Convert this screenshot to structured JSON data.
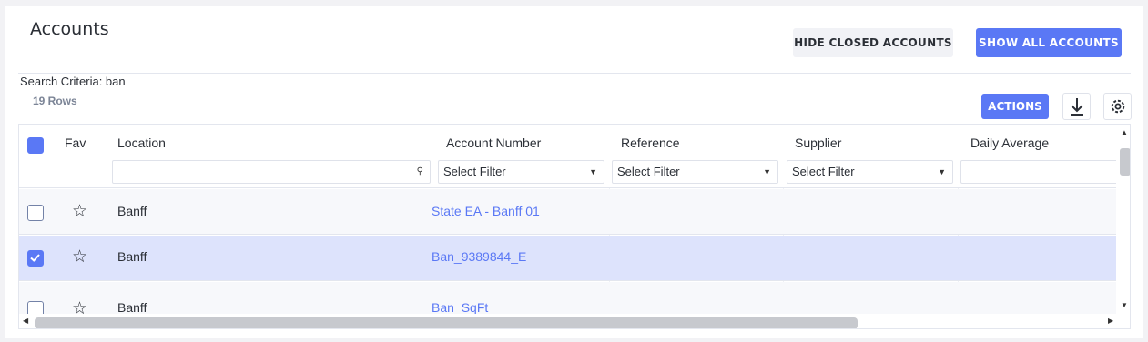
{
  "page": {
    "title": "Accounts"
  },
  "toolbar": {
    "hide_closed_label": "HIDE CLOSED ACCOUNTS",
    "show_all_label": "SHOW ALL ACCOUNTS",
    "actions_label": "ACTIONS"
  },
  "search": {
    "criteria": "Search Criteria: ban",
    "row_count": "19 Rows"
  },
  "icons": {
    "download": "download-icon",
    "settings": "gear-icon",
    "favorite": "star-icon",
    "filter_search": "search-icon"
  },
  "colors": {
    "accent": "#5a78f5",
    "selected_row": "#dde3fc"
  },
  "table": {
    "columns": [
      "Fav",
      "Location",
      "Account Number",
      "Reference",
      "Supplier",
      "Daily Average"
    ],
    "filters": {
      "location": "",
      "account_number": "Select Filter",
      "reference": "Select Filter",
      "supplier": "Select Filter",
      "daily_average": ""
    },
    "rows": [
      {
        "checked": false,
        "star": "☆",
        "location": "Banff",
        "account_number": "State EA - Banff 01"
      },
      {
        "checked": true,
        "star": "☆",
        "location": "Banff",
        "account_number": "Ban_9389844_E"
      },
      {
        "checked": false,
        "star": "☆",
        "location": "Banff",
        "account_number": "Ban_SqFt"
      }
    ]
  }
}
